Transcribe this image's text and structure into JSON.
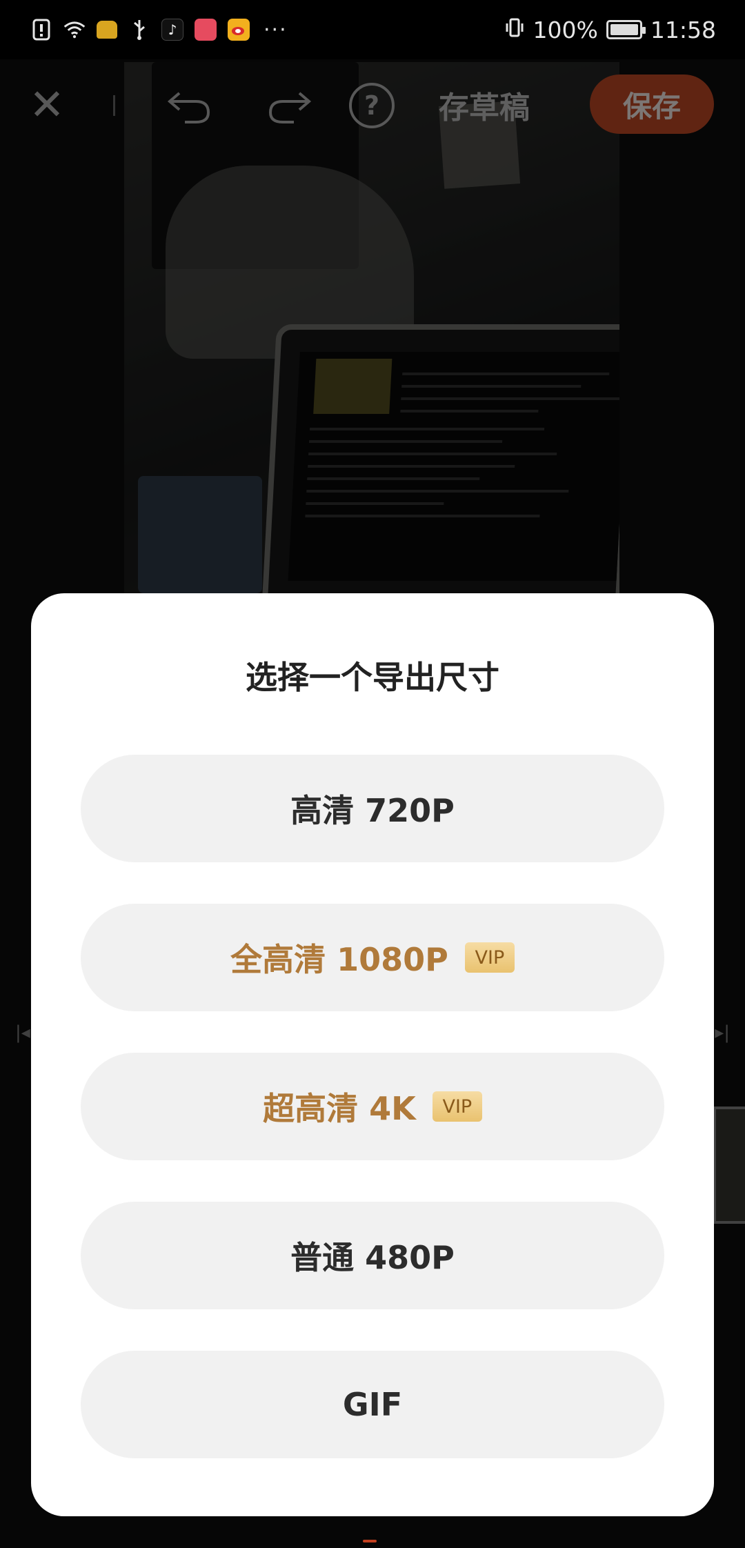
{
  "status_bar": {
    "battery_percent": "100%",
    "time": "11:58",
    "icons": [
      "alert-icon",
      "wifi-icon",
      "taxi-app-icon",
      "usb-icon",
      "tiktok-icon",
      "shopping-app-icon",
      "weibo-icon",
      "more-icon",
      "vibrate-icon",
      "battery-icon"
    ],
    "more": "···"
  },
  "toolbar": {
    "close": "✕",
    "help": "?",
    "draft_label": "存草稿",
    "save_label": "保存",
    "save_color": "#9b3b1e"
  },
  "timeline": {
    "left_handle": "|◂",
    "right_handle": "▸|"
  },
  "export_dialog": {
    "title": "选择一个导出尺寸",
    "options": [
      {
        "label": "高清 720P",
        "vip": false
      },
      {
        "label": "全高清 1080P",
        "vip": true,
        "badge": "VIP"
      },
      {
        "label": "超高清 4K",
        "vip": true,
        "badge": "VIP"
      },
      {
        "label": "普通 480P",
        "vip": false
      },
      {
        "label": "GIF",
        "vip": false
      }
    ],
    "vip_text_color": "#b07a3a"
  }
}
